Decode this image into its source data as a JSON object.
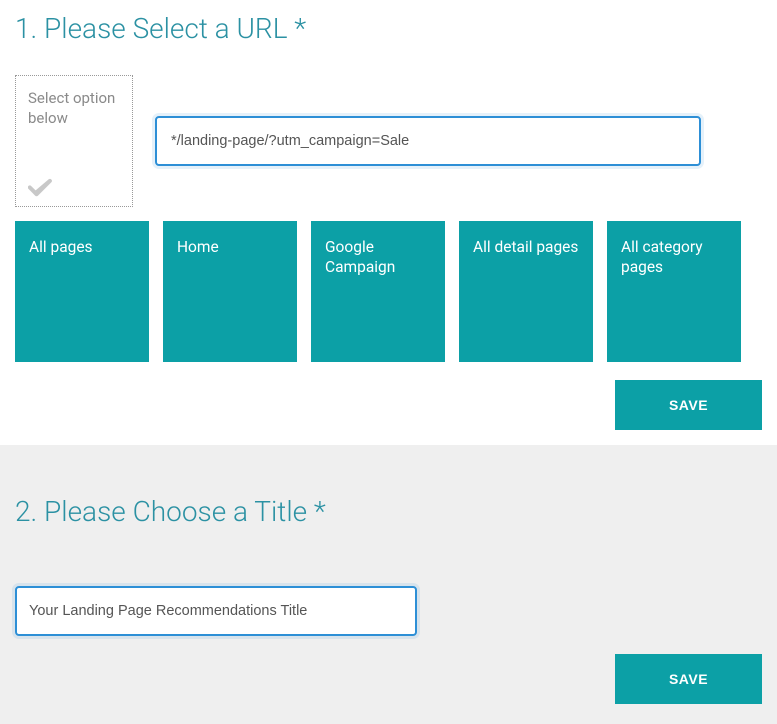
{
  "section1": {
    "heading": "1. Please Select a URL *",
    "select_card_label": "Select option below",
    "url_value": "*/landing-page/?utm_campaign=Sale",
    "tiles": [
      "All pages",
      "Home",
      "Google Campaign",
      "All detail pages",
      "All category pages"
    ],
    "save_label": "SAVE"
  },
  "section2": {
    "heading": "2. Please Choose a Title *",
    "title_value": "Your Landing Page Recommendations Title",
    "save_label": "SAVE"
  },
  "colors": {
    "accent": "#0ca0a6",
    "heading": "#2b91a3",
    "focus_border": "#2d8fd6"
  }
}
